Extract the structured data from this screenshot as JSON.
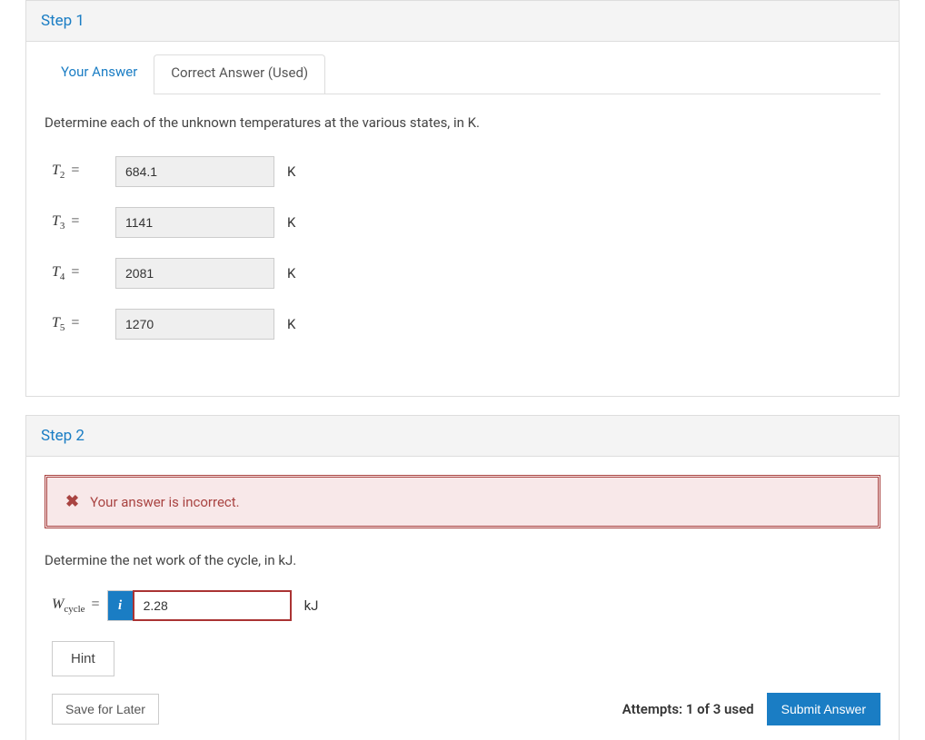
{
  "step1": {
    "title": "Step 1",
    "tabs": {
      "your_answer": "Your Answer",
      "correct_answer": "Correct Answer (Used)"
    },
    "prompt": "Determine each of the unknown temperatures at the various states, in K.",
    "rows": [
      {
        "var": "T",
        "sub": "2",
        "value": "684.1",
        "unit": "K"
      },
      {
        "var": "T",
        "sub": "3",
        "value": "1141",
        "unit": "K"
      },
      {
        "var": "T",
        "sub": "4",
        "value": "2081",
        "unit": "K"
      },
      {
        "var": "T",
        "sub": "5",
        "value": "1270",
        "unit": "K"
      }
    ]
  },
  "step2": {
    "title": "Step 2",
    "error_message": "Your answer is incorrect.",
    "prompt": "Determine the net work of the cycle, in kJ.",
    "var": "W",
    "sub": "cycle",
    "value": "2.28",
    "unit": "kJ",
    "hint_label": "Hint",
    "save_label": "Save for Later",
    "attempts": "Attempts: 1 of 3 used",
    "submit_label": "Submit Answer"
  }
}
